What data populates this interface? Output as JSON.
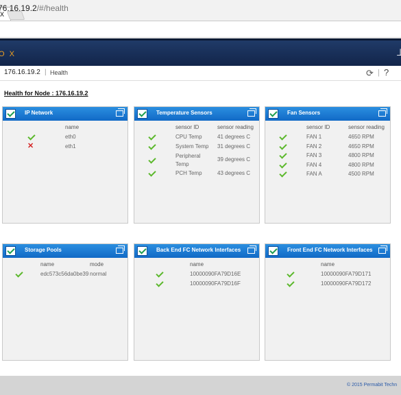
{
  "browser": {
    "tab_close": "x",
    "url_host": "76.16.19.2",
    "url_path": "/#/health"
  },
  "header": {
    "logo": "O X",
    "accent_color": "#f0a020",
    "bar_color": "#1b3360"
  },
  "breadcrumb": {
    "ip": "176.16.19.2",
    "separator": "|",
    "page": "Health",
    "divider": "|"
  },
  "health_title": "Health for Node : 176.16.19.2",
  "panels": {
    "ip_network": {
      "title": "IP Network",
      "col_name": "name",
      "rows": [
        {
          "status": "ok",
          "name": "eth0"
        },
        {
          "status": "error",
          "name": "eth1"
        }
      ]
    },
    "temperature": {
      "title": "Temperature Sensors",
      "col_id": "sensor ID",
      "col_reading": "sensor reading",
      "rows": [
        {
          "id": "CPU Temp",
          "reading": "41 degrees C"
        },
        {
          "id": "System Temp",
          "reading": "31 degrees C"
        },
        {
          "id": "Peripheral Temp",
          "reading": "39 degrees C"
        },
        {
          "id": "PCH Temp",
          "reading": "43 degrees C"
        }
      ]
    },
    "fans": {
      "title": "Fan Sensors",
      "col_id": "sensor ID",
      "col_reading": "sensor reading",
      "rows": [
        {
          "id": "FAN 1",
          "reading": "4650 RPM"
        },
        {
          "id": "FAN 2",
          "reading": "4650 RPM"
        },
        {
          "id": "FAN 3",
          "reading": "4800 RPM"
        },
        {
          "id": "FAN 4",
          "reading": "4800 RPM"
        },
        {
          "id": "FAN A",
          "reading": "4500 RPM"
        }
      ]
    },
    "storage": {
      "title": "Storage Pools",
      "col_name": "name",
      "col_mode": "mode",
      "rows": [
        {
          "name": "edc573c56da0be39",
          "mode": "normal"
        }
      ]
    },
    "backend_fc": {
      "title": "Back End FC Network Interfaces",
      "col_name": "name",
      "rows": [
        {
          "name": "10000090FA79D16E"
        },
        {
          "name": "10000090FA79D16F"
        }
      ]
    },
    "frontend_fc": {
      "title": "Front End FC Network Interfaces",
      "col_name": "name",
      "rows": [
        {
          "name": "10000090FA79D171"
        },
        {
          "name": "10000090FA79D172"
        }
      ]
    }
  },
  "footer": {
    "text": "© 2015 Permabit Techn"
  },
  "colors": {
    "ok": "#5cb82c",
    "error": "#d42525",
    "panel_header": "#1a7ad6"
  }
}
